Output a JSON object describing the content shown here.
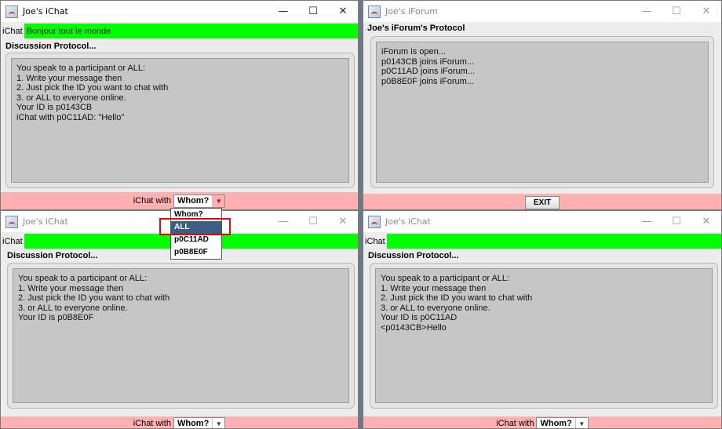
{
  "colors": {
    "input_bg": "#00ff00",
    "bottom_bar": "#ffb0b0",
    "selected_option": "#3d5e82",
    "highlight": "#d01010"
  },
  "icons": {
    "app": "java-coffee-icon",
    "minimize": "minimize-icon",
    "maximize": "maximize-icon",
    "close": "close-icon"
  },
  "controls": {
    "minimize": "—",
    "maximize": "☐",
    "close": "✕"
  },
  "windows": {
    "chat1": {
      "title": "Joe's iChat",
      "input_label": "iChat",
      "input_value": "Bonjour tout le monde",
      "protocol_label": "Discussion Protocol...",
      "protocol_text": "You speak to a participant or ALL:\n1. Write your message then\n2. Just pick the ID you want to chat with\n3. or ALL to everyone online.\nYour ID is p0143CB\niChat with p0C11AD: \"Hello\"",
      "chat_with_label": "iChat with",
      "combo_value": "Whom?"
    },
    "forum": {
      "title": "Joe's iForum",
      "protocol_label": "Joe's iForum's Protocol",
      "protocol_text": "iForum is open...\np0143CB joins iForum...\np0C11AD joins iForum...\np0B8E0F joins iForum...",
      "exit_label": "EXIT"
    },
    "chat2": {
      "title": "Joe's iChat",
      "input_label": "iChat",
      "input_value": "",
      "protocol_label": "Discussion Protocol...",
      "protocol_text": "You speak to a participant or ALL:\n1. Write your message then\n2. Just pick the ID you want to chat with\n3. or ALL to everyone online.\nYour ID is p0B8E0F",
      "chat_with_label": "iChat with",
      "combo_value": "Whom?"
    },
    "chat3": {
      "title": "Joe's iChat",
      "input_label": "iChat",
      "input_value": "",
      "protocol_label": "Discussion Protocol...",
      "protocol_text": "You speak to a participant or ALL:\n1. Write your message then\n2. Just pick the ID you want to chat with\n3. or ALL to everyone online.\nYour ID is p0C11AD\n<p0143CB>Hello",
      "chat_with_label": "iChat with",
      "combo_value": "Whom?"
    }
  },
  "dropdown": {
    "options": [
      "Whom?",
      "ALL",
      "p0C11AD",
      "p0B8E0F"
    ],
    "selected": "ALL"
  }
}
